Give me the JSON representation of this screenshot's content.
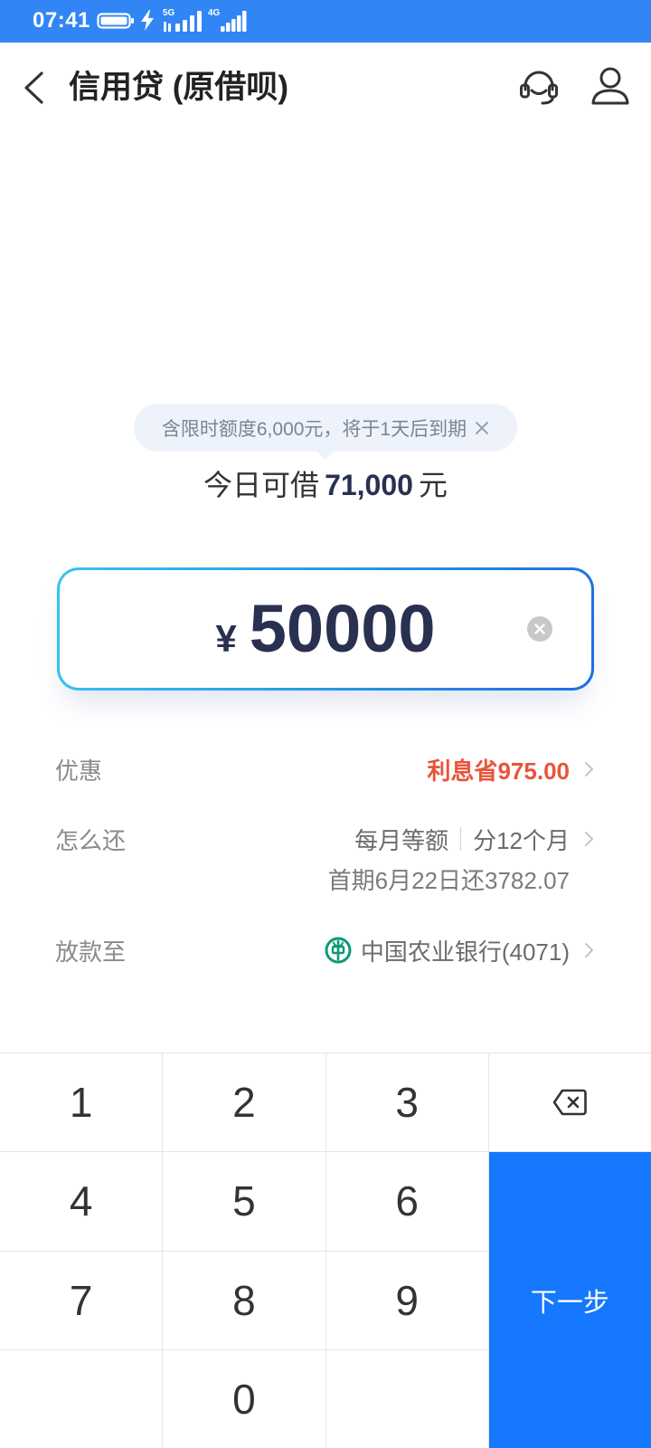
{
  "status_bar": {
    "time": "07:41",
    "network_primary": "5G",
    "network_secondary": "4G",
    "battery_icon": "battery-icon",
    "charging_icon": "charging-icon",
    "signal_icon": "signal-icon"
  },
  "header": {
    "title": "信用贷 (原借呗)",
    "back_icon": "back-chevron-icon",
    "service_icon": "customer-service-icon",
    "profile_icon": "user-icon"
  },
  "quota": {
    "notice": "含限时额度6,000元，将于1天后到期",
    "notice_close_icon": "close-icon",
    "available_prefix": "今日可借",
    "available_amount": "71,000",
    "available_unit": "元"
  },
  "amount_input": {
    "currency_symbol": "¥",
    "value": "50000",
    "clear_icon": "clear-icon"
  },
  "details": {
    "discount": {
      "label": "优惠",
      "value": "利息省975.00"
    },
    "repayment": {
      "label": "怎么还",
      "method": "每月等额",
      "term": "分12个月",
      "first_installment": "首期6月22日还3782.07"
    },
    "disbursement": {
      "label": "放款至",
      "bank": "中国农业银行(4071)",
      "bank_icon": "agricultural-bank-logo-icon"
    }
  },
  "keypad": {
    "keys": [
      "1",
      "2",
      "3",
      "4",
      "5",
      "6",
      "7",
      "8",
      "9",
      "0"
    ],
    "delete_icon": "backspace-icon",
    "next_label": "下一步"
  },
  "colors": {
    "status_bar": "#3285f5",
    "primary_button": "#1677ff",
    "discount_text": "#e8543a",
    "amount_text": "#2a3050",
    "input_border_start": "#36c4f0",
    "input_border_end": "#1c6fe0",
    "notice_background": "#eef3fb"
  }
}
